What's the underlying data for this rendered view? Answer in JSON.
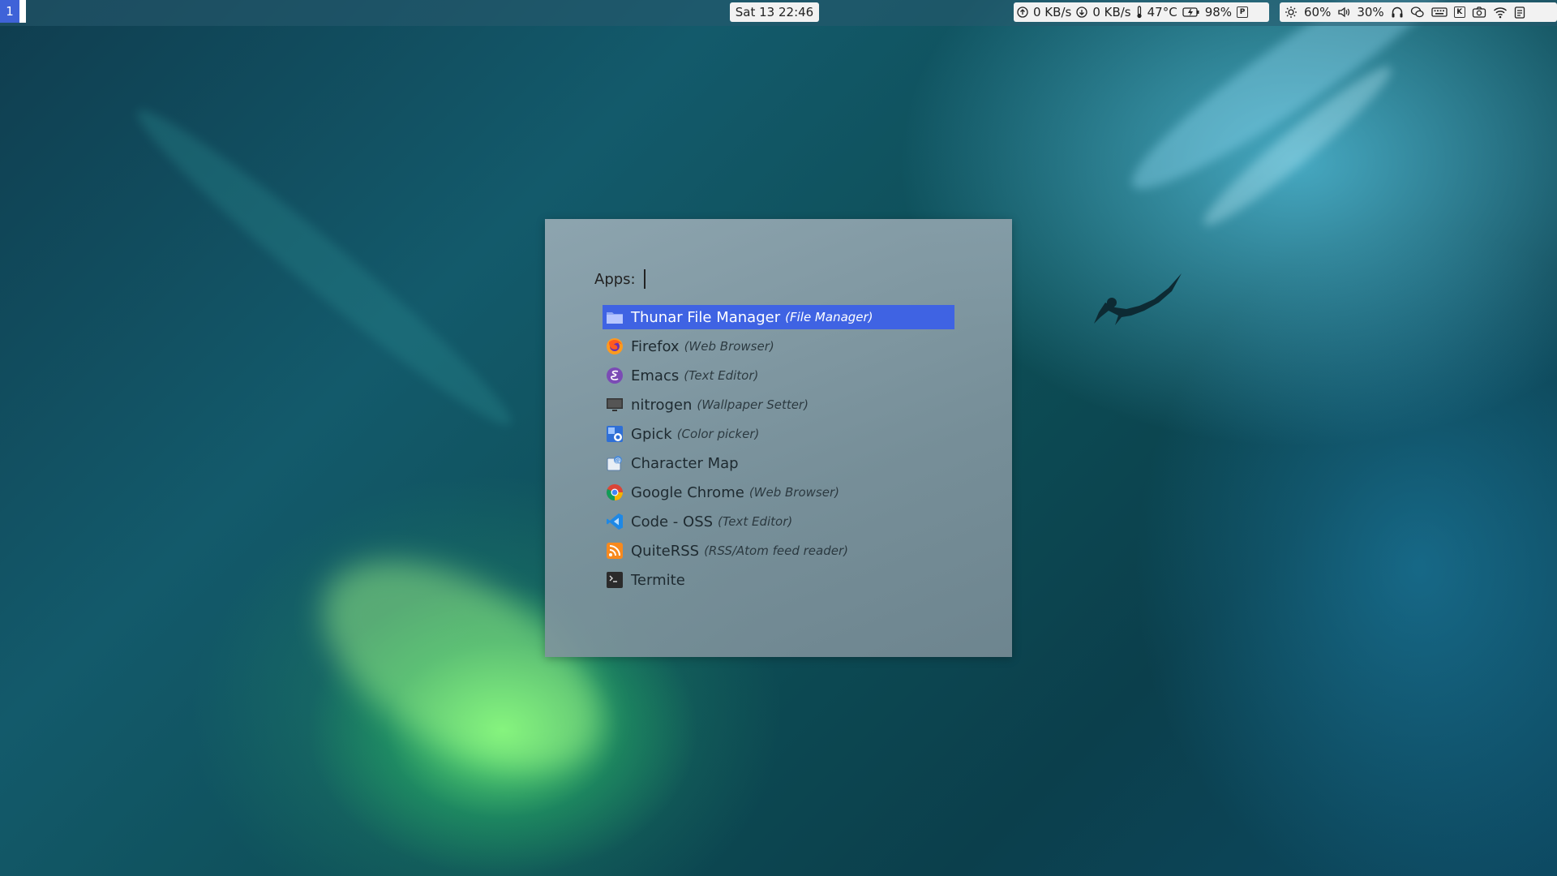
{
  "topbar": {
    "workspace": "1",
    "clock": "Sat 13 22:46",
    "net_up": "0 KB/s",
    "net_down": "0 KB/s",
    "temperature": "47°C",
    "battery": "98%",
    "brightness": "60%",
    "volume": "30%",
    "icons": [
      "upload-icon",
      "download-icon",
      "thermometer-icon",
      "battery-icon",
      "keyboard-layout-icon",
      "brightness-icon",
      "volume-icon",
      "headphones-icon",
      "wechat-icon",
      "keyboard-icon",
      "kdeconnect-icon",
      "screenshot-icon",
      "wifi-icon",
      "clipboard-icon"
    ]
  },
  "launcher": {
    "prompt": "Apps:",
    "items": [
      {
        "name": "Thunar File Manager",
        "desc": "(File Manager)",
        "icon": "folder-icon",
        "selected": true
      },
      {
        "name": "Firefox",
        "desc": "(Web Browser)",
        "icon": "firefox-icon",
        "selected": false
      },
      {
        "name": "Emacs",
        "desc": "(Text Editor)",
        "icon": "emacs-icon",
        "selected": false
      },
      {
        "name": "nitrogen",
        "desc": "(Wallpaper Setter)",
        "icon": "monitor-icon",
        "selected": false
      },
      {
        "name": "Gpick",
        "desc": "(Color picker)",
        "icon": "gpick-icon",
        "selected": false
      },
      {
        "name": "Character Map",
        "desc": "",
        "icon": "charmap-icon",
        "selected": false
      },
      {
        "name": "Google Chrome",
        "desc": "(Web Browser)",
        "icon": "chrome-icon",
        "selected": false
      },
      {
        "name": "Code - OSS",
        "desc": "(Text Editor)",
        "icon": "vscode-icon",
        "selected": false
      },
      {
        "name": "QuiteRSS",
        "desc": "(RSS/Atom feed reader)",
        "icon": "rss-icon",
        "selected": false
      },
      {
        "name": "Termite",
        "desc": "",
        "icon": "terminal-icon",
        "selected": false
      }
    ]
  },
  "colors": {
    "accent": "#3f63e3",
    "workspace": "#3f63d8"
  }
}
